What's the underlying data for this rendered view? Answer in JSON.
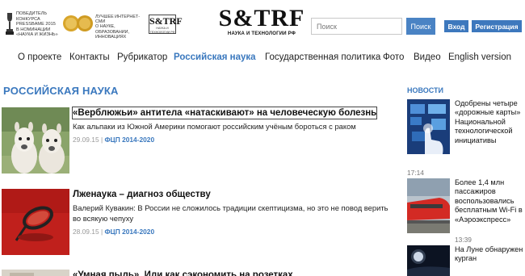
{
  "header": {
    "award_text": [
      "ПОБЕДИТЕЛЬ",
      "КОНКУРСА",
      "PRESSBAME 2015",
      "В НОМИНАЦИИ",
      "«НАУКА И ЖИЗНЬ»"
    ],
    "badge_text": [
      "ЛУЧШЕЕ ИНТЕРНЕТ-СМИ",
      "О НАУКЕ, ОБРАЗОВАНИИ,",
      "ИННОВАЦИЯХ"
    ],
    "mini_logo_main": "S&TRF",
    "mini_logo_sub": "НАУКА И ТЕХНОЛОГИИ РФ",
    "logo_main": "S&TRF",
    "logo_sub": "НАУКА И ТЕХНОЛОГИИ РФ",
    "search_placeholder": "Поиск",
    "search_button": "Поиск",
    "login_button": "Вход",
    "register_button": "Регистрация"
  },
  "nav": {
    "items": [
      "О проекте",
      "Контакты",
      "Рубрикатор",
      "Российская наука",
      "Государственная политика",
      "Фото",
      "Видео",
      "English version"
    ],
    "active_index": 3
  },
  "section_title": "РОССИЙСКАЯ НАУКА",
  "articles": [
    {
      "title": "«Верблюжьи» антитела «натаскивают» на человеческую болезнь",
      "lead": "Как альпаки из Южной Америки помогают российским учёным бороться с раком",
      "date": "29.09.15",
      "separator": "|",
      "tag": "ФЦП 2014-2020"
    },
    {
      "title": "Лженаука – диагноз обществу",
      "lead": "Валерий Кувакин: В России не сложилось традиции скептицизма, но это не повод верить во всякую чепуху",
      "date": "28.09.15",
      "separator": "|",
      "tag": "ФЦП 2014-2020"
    },
    {
      "title": "«Умная пыль». Или как сэкономить на розетках"
    }
  ],
  "sidebar": {
    "title": "НОВОСТИ",
    "items": [
      {
        "text": "Одобрены четыре «дорожные карты» Национальной технологической инициативы",
        "time": "17:14"
      },
      {
        "text": "Более 1,4 млн пассажиров воспользовались бесплатным Wi-Fi в «Аэроэкспресс»",
        "time": "13:39"
      },
      {
        "text": "На Луне обнаружен курган"
      }
    ]
  },
  "colors": {
    "accent": "#3a78be",
    "button": "#4a83c4"
  }
}
